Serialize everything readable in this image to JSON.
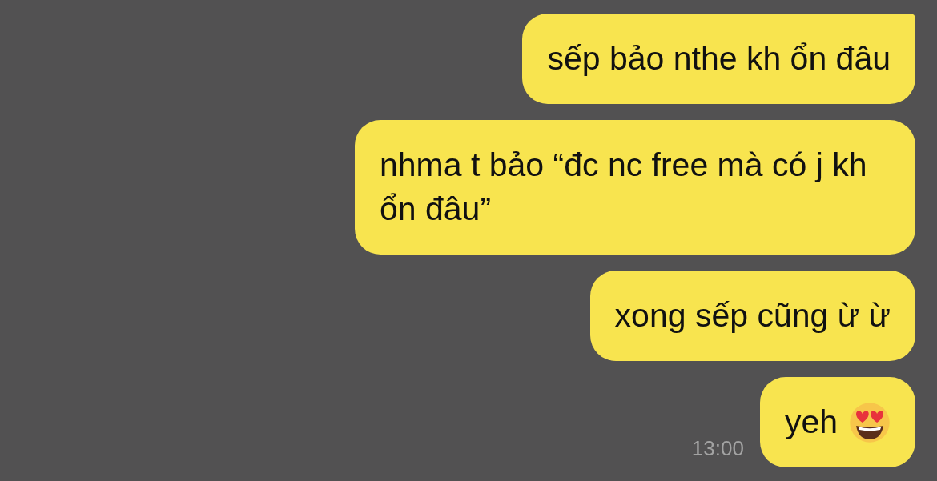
{
  "messages": [
    {
      "text": "sếp bảo nthe kh ổn đâu",
      "kind": "text",
      "tail": true
    },
    {
      "text": "nhma t bảo “đc nc free mà có j kh ổn đâu”",
      "kind": "text",
      "tail": false
    },
    {
      "text": "xong sếp cũng ừ ừ",
      "kind": "text",
      "tail": false
    },
    {
      "text": "yeh",
      "kind": "reaction",
      "tail": false,
      "time": "13:00"
    }
  ]
}
